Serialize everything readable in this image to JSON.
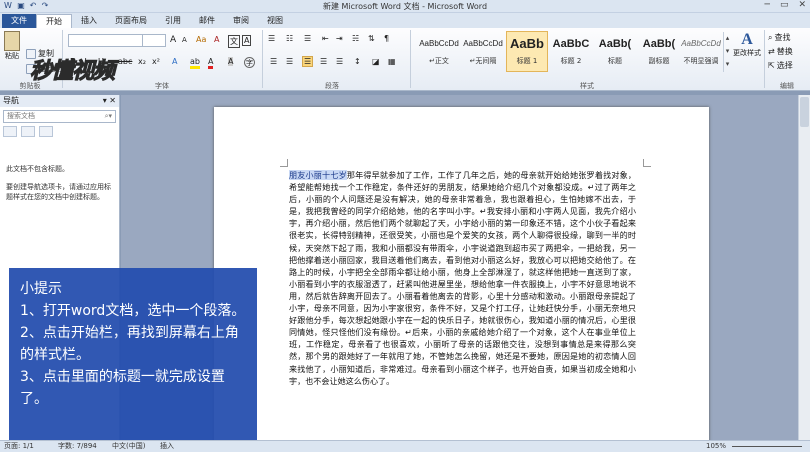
{
  "window": {
    "title": "新建 Microsoft Word 文档 - Microsoft Word"
  },
  "tabs": [
    {
      "label": "文件"
    },
    {
      "label": "开始"
    },
    {
      "label": "插入"
    },
    {
      "label": "页面布局"
    },
    {
      "label": "引用"
    },
    {
      "label": "邮件"
    },
    {
      "label": "审阅"
    },
    {
      "label": "视图"
    }
  ],
  "ribbon": {
    "clipboard": {
      "paste": "粘贴",
      "copy": "复制",
      "format_painter": "格式刷",
      "group": "剪贴板"
    },
    "font": {
      "group": "字体"
    },
    "paragraph": {
      "group": "段落"
    },
    "styles": {
      "group": "样式",
      "items": [
        {
          "preview": "AaBbCcDd",
          "name": "↵正文"
        },
        {
          "preview": "AaBbCcDd",
          "name": "↵无间隔"
        },
        {
          "preview": "AaBb",
          "name": "标题 1"
        },
        {
          "preview": "AaBbC",
          "name": "标题 2"
        },
        {
          "preview": "AaBb(",
          "name": "标题"
        },
        {
          "preview": "AaBb(",
          "name": "副标题"
        },
        {
          "preview": "AaBbCcDd",
          "name": "不明显强调"
        }
      ],
      "change_styles": "更改样式"
    },
    "editing": {
      "find": "查找",
      "replace": "替换",
      "select": "选择",
      "group": "编辑"
    }
  },
  "watermark_logo": "秒懂视频",
  "nav": {
    "title": "导航",
    "search_placeholder": "搜索文档",
    "message1": "此文档不包含标题。",
    "message2": "要创建导航选项卡，请通过应用标题样式在您的文档中创建标题。"
  },
  "doc": {
    "highlight": "朋友小丽十七岁",
    "body": "那年得早就参加了工作，工作了几年之后，她的母亲就开始给她张罗着找对象，希望能帮她找一个工作稳定，条件还好的男朋友，结果她给介绍几个对象都没成。↵过了两年之后，小丽的个人问题还是没有解决，她的母亲非常着急，我也跟着担心，生怕她嫁不出去，于是，我把我曾经的同学介绍给她，他的名字叫小宇。↵我安排小丽和小宇两人见面，我先介绍小宇，再介绍小丽，然后他们两个就聊起了天，小宇给小丽的第一印象还不错，这个小伙子看起来很老实，长得特别精神，还很受笑，小丽也是个爱笑的女孩，两个人聊得很投缘，聊到一半的时候，天突然下起了雨，我和小丽都没有带雨伞，小宇说道跑到超市买了两把伞，一把给我，另一把他撑着送小丽回家，我目送着他们离去，看到他对小丽这么好，我放心可以把她交给他了。在路上的时候，小宇把全全部雨伞都让给小丽，他身上全部淋湿了，就这样他把她一直送到了家，小丽看到小宇的衣服湿透了，赶紧叫他进屋里坐，想给他拿一件衣服换上，小宇不好意思地说不用，然后就告辞离开回去了。小丽看着他离去的背影，心里十分感动和激动。小丽跟母亲提起了小宇，母亲不同意，因为小宇家很穷，条件不好，又是个打工仔，让她赶快分手，小丽无奈地只好跟他分手，每次想起她跟小宇在一起的快乐日子，她就很伤心，我知道小丽的情况后，心里很同情她，怪只怪他们没有缘份。↵后来，小丽的亲戚给她介绍了一个对象，这个人在事业单位上班，工作稳定，母亲看了也很喜欢，小丽听了母亲的话跟他交往，没想到事情总是来得那么突然，那个男的跟她好了一年就甩了她，不管她怎么挽留，她还是不要她，原因是她的初恋情人回来找他了，小丽知道后，非常难过。母亲看到小丽这个样子，也开始自责，如果当初成全她和小宇，也不会让她这么伤心了。"
  },
  "tip": {
    "title": "小提示",
    "step1": "1、打开word文档，选中一个段落。",
    "step2": "2、点击开始栏，再找到屏幕右上角的样式栏。",
    "step3": "3、点击里面的标题一就完成设置了。"
  },
  "status": {
    "page": "页面: 1/1",
    "words": "字数: 7/894",
    "lang": "中文(中国)",
    "mode": "插入",
    "zoom": "105%"
  }
}
